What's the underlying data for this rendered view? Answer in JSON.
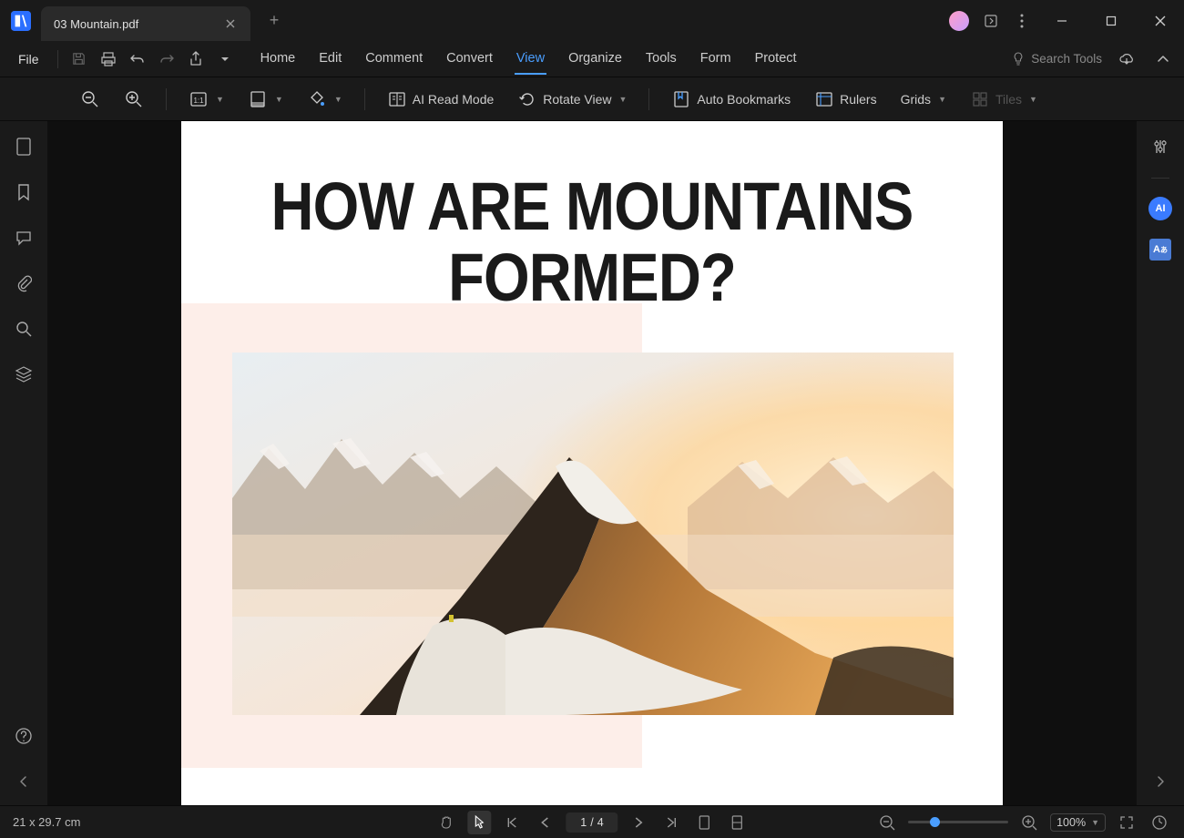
{
  "tab": {
    "title": "03 Mountain.pdf"
  },
  "menu": {
    "file": "File",
    "tabs": [
      "Home",
      "Edit",
      "Comment",
      "Convert",
      "View",
      "Organize",
      "Tools",
      "Form",
      "Protect"
    ],
    "active": "View",
    "search_placeholder": "Search Tools"
  },
  "ribbon": {
    "ai_read": "AI Read Mode",
    "rotate": "Rotate View",
    "auto_bookmarks": "Auto Bookmarks",
    "rulers": "Rulers",
    "grids": "Grids",
    "tiles": "Tiles"
  },
  "document": {
    "heading": "HOW ARE MOUNTAINS FORMED?"
  },
  "status": {
    "dimensions": "21 x 29.7 cm",
    "page_current": "1",
    "page_total": "4",
    "zoom": "100%"
  }
}
